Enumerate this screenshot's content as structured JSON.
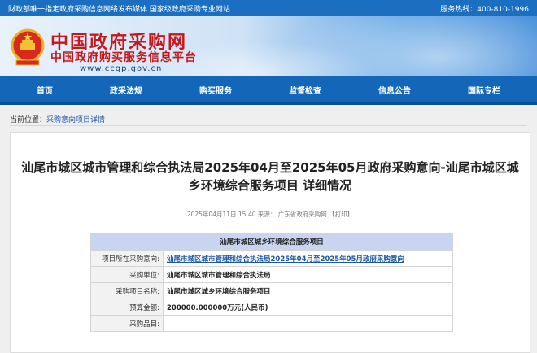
{
  "topbar": {
    "left": "财政部唯一指定政府采购信息网络发布媒体 国家级政府采购专业网站",
    "right": "服务热线：400-810-1996"
  },
  "logo": {
    "title": "中国政府采购网",
    "subtitle": "中国政府购买服务信息平台",
    "url": "www.ccgp.gov.cn"
  },
  "nav": {
    "items": [
      {
        "label": "首页"
      },
      {
        "label": "政采法规"
      },
      {
        "label": "购买服务"
      },
      {
        "label": "监督检查"
      },
      {
        "label": "信息公告"
      },
      {
        "label": "国际专栏"
      }
    ]
  },
  "breadcrumb": {
    "prefix": "当前位置：",
    "item": "采购意向项目详情"
  },
  "article": {
    "title": "汕尾市城区城市管理和综合执法局2025年04月至2025年05月政府采购意向-汕尾市城区城乡环境综合服务项目 详细情况",
    "date": "2025年04月11日 15:40",
    "source_label": "来源：",
    "source": "广东省政府采购网",
    "print": "【打印】"
  },
  "table": {
    "header": "汕尾市城区城乡环境综合服务项目",
    "rows": [
      {
        "label": "项目所在采购意向:",
        "value": "汕尾市城区城市管理和综合执法局2025年04月至2025年05月政府采购意向"
      },
      {
        "label": "采购单位:",
        "value": "汕尾市城区城市管理和综合执法局"
      },
      {
        "label": "采购项目名称:",
        "value": "汕尾市城区城乡环境综合服务项目"
      },
      {
        "label": "预算金额:",
        "value": "200000.000000万元(人民币)"
      },
      {
        "label": "采购品目:",
        "value": ""
      }
    ]
  }
}
